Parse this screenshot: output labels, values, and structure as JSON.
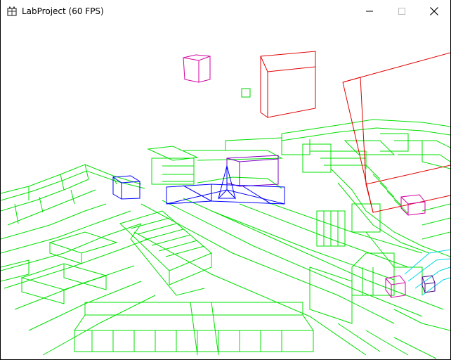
{
  "window": {
    "title": "LabProject (60 FPS)",
    "icons": {
      "app": "app-window-icon",
      "minimize": "minimize-icon",
      "maximize": "maximize-icon",
      "close": "close-icon"
    }
  },
  "scene": {
    "colors": {
      "terrain": "#00e000",
      "player": "#0000ff",
      "cube_magenta": "#d000a0",
      "cube_red": "#e00000",
      "cube_purple": "#8000c0",
      "cube_cyan": "#00d8e0"
    }
  }
}
